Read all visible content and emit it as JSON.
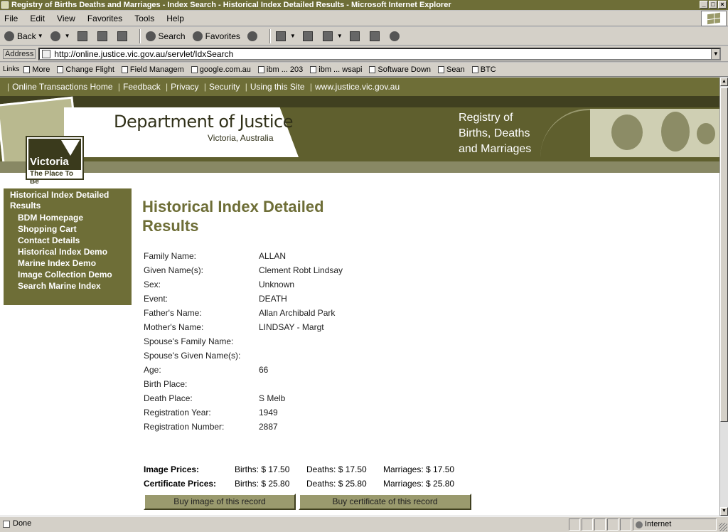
{
  "window": {
    "title": "Registry of Births Deaths and Marriages - Index Search - Historical Index Detailed Results - Microsoft Internet Explorer",
    "minimize_glyph": "_",
    "maximize_glyph": "□",
    "close_glyph": "×"
  },
  "menu": {
    "items": [
      "File",
      "Edit",
      "View",
      "Favorites",
      "Tools",
      "Help"
    ]
  },
  "toolbar": {
    "back": "Back",
    "search": "Search",
    "favorites": "Favorites",
    "dropdown_glyph": "▼"
  },
  "address": {
    "label": "Address",
    "url": "http://online.justice.vic.gov.au/servlet/IdxSearch",
    "dropdown_glyph": "▼"
  },
  "links": {
    "label": "Links",
    "items": [
      "More",
      "Change Flight",
      "Field Managem",
      "google.com.au",
      "ibm ... 203",
      "ibm ... wsapi",
      "Software Down",
      "Sean",
      "BTC"
    ]
  },
  "site_nav": {
    "separator": "|",
    "items": [
      "Online Transactions Home",
      "Feedback",
      "Privacy",
      "Security",
      "Using this Site",
      "www.justice.vic.gov.au"
    ]
  },
  "banner": {
    "department": "Department of Justice",
    "department_sub": "Victoria, Australia",
    "registry_line1": "Registry of",
    "registry_line2": "Births, Deaths",
    "registry_line3": "and Marriages",
    "victoria_logo_name": "Victoria",
    "victoria_logo_tagline": "The Place To Be"
  },
  "sidebar": {
    "current": "Historical Index Detailed Results",
    "items": [
      "BDM Homepage",
      "Shopping Cart",
      "Contact Details",
      "Historical Index Demo",
      "Marine Index Demo",
      "Image Collection Demo",
      "Search Marine Index"
    ]
  },
  "page": {
    "title": "Historical Index Detailed Results"
  },
  "record": [
    {
      "label": "Family Name:",
      "value": "ALLAN"
    },
    {
      "label": "Given Name(s):",
      "value": "Clement Robt Lindsay"
    },
    {
      "label": "Sex:",
      "value": "Unknown"
    },
    {
      "label": "Event:",
      "value": "DEATH"
    },
    {
      "label": "Father's Name:",
      "value": "Allan Archibald Park"
    },
    {
      "label": "Mother's Name:",
      "value": "LINDSAY - Margt"
    },
    {
      "label": "Spouse's Family Name:",
      "value": ""
    },
    {
      "label": "Spouse's Given Name(s):",
      "value": ""
    },
    {
      "label": "Age:",
      "value": "66"
    },
    {
      "label": "Birth Place:",
      "value": ""
    },
    {
      "label": "Death Place:",
      "value": "S Melb"
    },
    {
      "label": "Registration Year:",
      "value": "1949"
    },
    {
      "label": "Registration Number:",
      "value": "2887"
    }
  ],
  "prices": {
    "image": {
      "label": "Image Prices:",
      "births": "Births: $ 17.50",
      "deaths": "Deaths: $ 17.50",
      "marriages": "Marriages: $ 17.50"
    },
    "certificate": {
      "label": "Certificate Prices:",
      "births": "Births: $ 25.80",
      "deaths": "Deaths: $ 25.80",
      "marriages": "Marriages: $ 25.80"
    }
  },
  "buttons": {
    "buy_image": "Buy image of this record",
    "buy_certificate": "Buy certificate of this record"
  },
  "status": {
    "text": "Done",
    "zone": "Internet"
  },
  "colors": {
    "accent": "#6e6e37",
    "banner": "#5f5f2e"
  }
}
